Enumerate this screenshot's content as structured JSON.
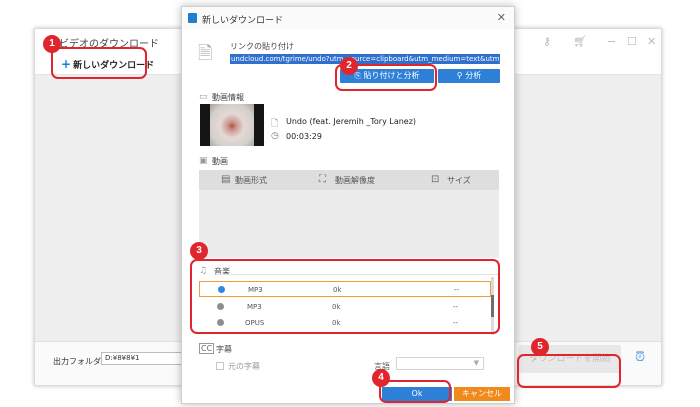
{
  "main_window": {
    "title": "ビデオのダウンロード",
    "toolbar_icons": [
      "key-icon",
      "cart-icon",
      "minimize-icon",
      "maximize-icon",
      "close-icon"
    ],
    "new_download_label": "新しいダウンロード",
    "output_folder_label": "出力フォルダ：",
    "output_folder_value": "D:¥8¥8¥1",
    "download_all_label": "ダウンロードを開始",
    "alarm_icon": "alarm-clock-icon"
  },
  "dialog": {
    "title": "新しいダウンロード",
    "link_label": "リンクの貼り付け",
    "url_value": "undcloud.com/tgrime/undo?utm_source=clipboard&utm_medium=text&utm_campaign=social_sharing",
    "paste_analyze_label": "貼り付けと分析",
    "analyze_label": "分析",
    "video_info_label": "動画情報",
    "video_title": "Undo (feat. Jeremih _Tory Lanez)",
    "video_duration": "00:03:29",
    "video_section_label": "動画",
    "video_columns": [
      "動画形式",
      "動画解像度",
      "サイズ"
    ],
    "audio_section_label": "音楽",
    "audio_rows": [
      {
        "format": "MP3",
        "bitrate": "0k",
        "size": "--",
        "selected": true
      },
      {
        "format": "MP3",
        "bitrate": "0k",
        "size": "--",
        "selected": false
      },
      {
        "format": "OPUS",
        "bitrate": "0k",
        "size": "--",
        "selected": false
      }
    ],
    "subtitle_section_label": "字幕",
    "original_subtitle_label": "元の字幕",
    "language_label": "言語",
    "ok_label": "Ok",
    "cancel_label": "キャンセル"
  },
  "annotations": {
    "step1": "1",
    "step2": "2",
    "step3": "3",
    "step4": "4",
    "step5": "5"
  },
  "colors": {
    "accent_blue": "#2e7fd8",
    "cancel_orange": "#f18a1c",
    "annotation_red": "#e1252d",
    "selected_row_border": "#f39b3a"
  }
}
